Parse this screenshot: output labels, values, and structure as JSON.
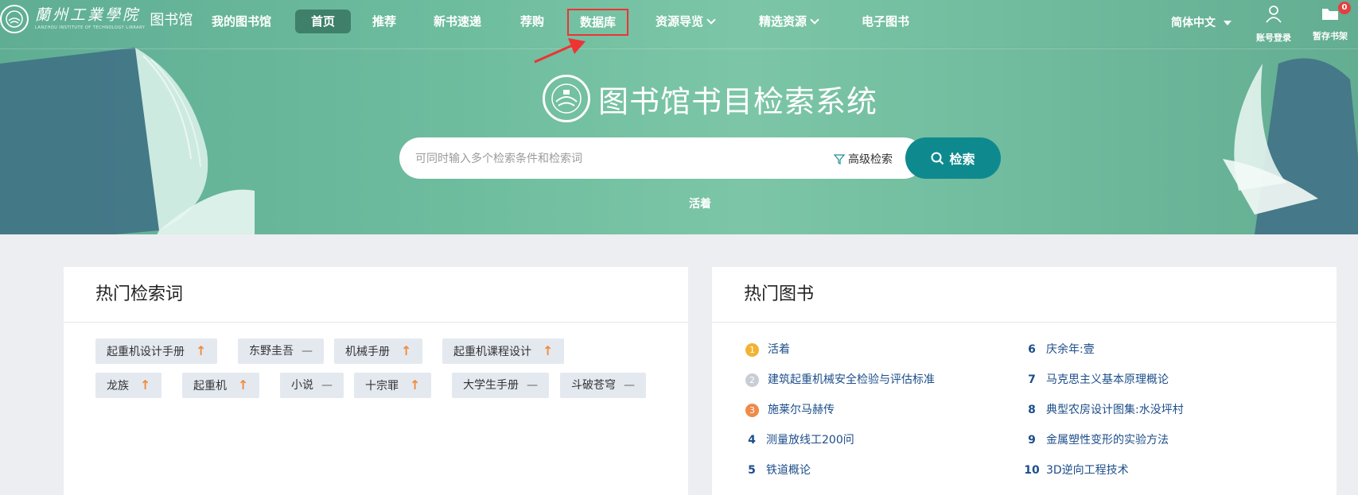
{
  "logo": {
    "cn": "蘭州工業學院",
    "en": "LANZHOU INSTITUTE OF TECHNOLOGY  LIBRARY",
    "lib": "图书馆"
  },
  "nav": {
    "items": [
      {
        "label": "我的图书馆"
      },
      {
        "label": "首页"
      },
      {
        "label": "推荐"
      },
      {
        "label": "新书速递"
      },
      {
        "label": "荐购"
      },
      {
        "label": "数据库"
      },
      {
        "label": "资源导览"
      },
      {
        "label": "精选资源"
      },
      {
        "label": "电子图书"
      }
    ],
    "lang": "简体中文",
    "login": "账号登录",
    "shelf": "暂存书架",
    "shelf_count": "0"
  },
  "hero": {
    "title": "图书馆书目检索系统",
    "search_placeholder": "可同时输入多个检索条件和检索词",
    "advanced": "高级检索",
    "search_button": "检索",
    "hot_link": "活着"
  },
  "hot_terms": {
    "title": "热门检索词",
    "tags": [
      {
        "label": "起重机设计手册",
        "trend": "↑"
      },
      {
        "label": "东野圭吾",
        "trend": "—"
      },
      {
        "label": "机械手册",
        "trend": "↑"
      },
      {
        "label": "起重机课程设计",
        "trend": "↑"
      },
      {
        "label": "龙族",
        "trend": "↑"
      },
      {
        "label": "起重机",
        "trend": "↑"
      },
      {
        "label": "小说",
        "trend": "—"
      },
      {
        "label": "十宗罪",
        "trend": "↑"
      },
      {
        "label": "大学生手册",
        "trend": "—"
      },
      {
        "label": "斗破苍穹",
        "trend": "—"
      }
    ]
  },
  "hot_books": {
    "title": "热门图书",
    "items": [
      {
        "rank": "1",
        "title": "活着"
      },
      {
        "rank": "2",
        "title": "建筑起重机械安全检验与评估标准"
      },
      {
        "rank": "3",
        "title": "施莱尔马赫传"
      },
      {
        "rank": "4",
        "title": "测量放线工200问"
      },
      {
        "rank": "5",
        "title": "铁道概论"
      },
      {
        "rank": "6",
        "title": "庆余年:壹"
      },
      {
        "rank": "7",
        "title": "马克思主义基本原理概论"
      },
      {
        "rank": "8",
        "title": "典型农房设计图集:水没坪村"
      },
      {
        "rank": "9",
        "title": "金属塑性变形的实验方法"
      },
      {
        "rank": "10",
        "title": "3D逆向工程技术"
      }
    ]
  },
  "colors": {
    "accent": "#0e8a8f",
    "hero": "#6fbd9f",
    "highlight_box": "#e33333",
    "gold": "#f2b233",
    "silver": "#c9cdd6",
    "bronze": "#ef8a4a"
  }
}
